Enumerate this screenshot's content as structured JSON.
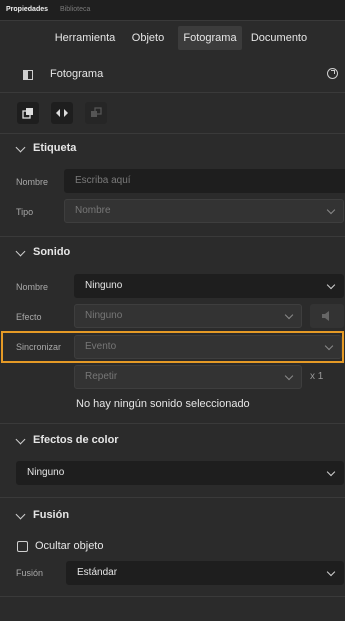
{
  "panel_tabs": {
    "properties": "Propiedades",
    "library": "Biblioteca"
  },
  "tabs": [
    "Herramienta",
    "Objeto",
    "Fotograma",
    "Documento"
  ],
  "active_tab": "Fotograma",
  "header": {
    "title": "Fotograma"
  },
  "label_section": {
    "title": "Etiqueta",
    "name_label": "Nombre",
    "name_placeholder": "Escriba aquí",
    "type_label": "Tipo",
    "type_value": "Nombre"
  },
  "sound_section": {
    "title": "Sonido",
    "name_label": "Nombre",
    "name_value": "Ninguno",
    "effect_label": "Efecto",
    "effect_value": "Ninguno",
    "sync_label": "Sincronizar",
    "sync_value": "Evento",
    "repeat_value": "Repetir",
    "repeat_count": "x 1",
    "status": "No hay ningún sonido seleccionado"
  },
  "color_section": {
    "title": "Efectos de color",
    "value": "Ninguno"
  },
  "blend_section": {
    "title": "Fusión",
    "hide_object_label": "Ocultar objeto",
    "blend_label": "Fusión",
    "blend_value": "Estándar"
  },
  "colors": {
    "highlight": "#e59a26",
    "background": "#2b2b2b"
  }
}
